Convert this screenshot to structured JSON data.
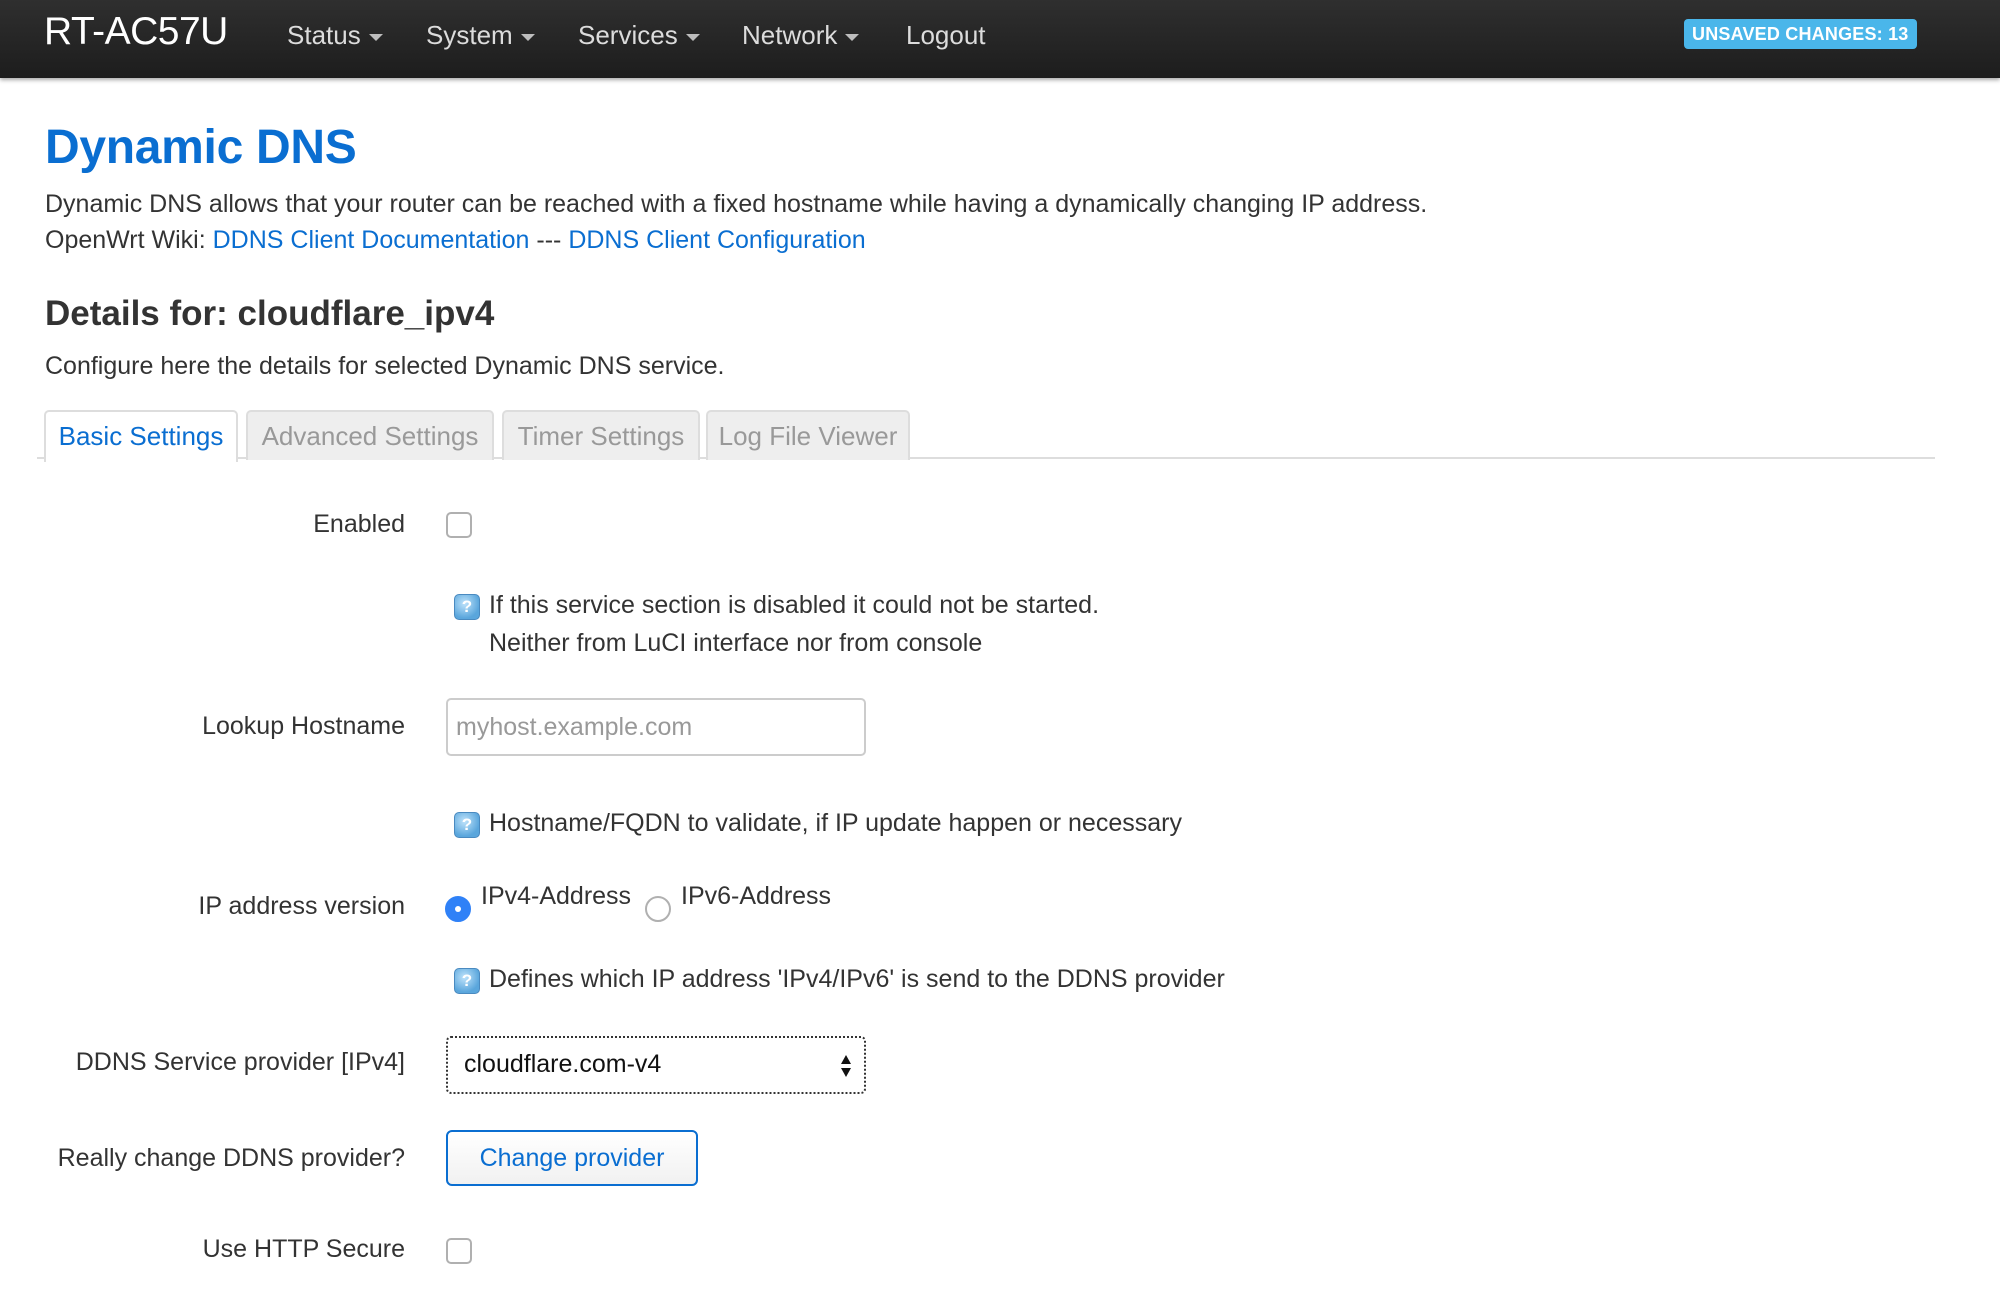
{
  "header": {
    "brand": "RT-AC57U",
    "nav": [
      "Status",
      "System",
      "Services",
      "Network",
      "Logout"
    ],
    "unsaved_badge": "UNSAVED CHANGES: 13"
  },
  "page": {
    "title": "Dynamic DNS",
    "description": "Dynamic DNS allows that your router can be reached with a fixed hostname while having a dynamically changing IP address.",
    "wiki_prefix": "OpenWrt Wiki:",
    "wiki_link_1": "DDNS Client Documentation",
    "wiki_separator": "---",
    "wiki_link_2": "DDNS Client Configuration"
  },
  "details": {
    "title": "Details for: cloudflare_ipv4",
    "subtitle": "Configure here the details for selected Dynamic DNS service."
  },
  "tabs": [
    {
      "label": "Basic Settings",
      "active": true
    },
    {
      "label": "Advanced Settings",
      "active": false
    },
    {
      "label": "Timer Settings",
      "active": false
    },
    {
      "label": "Log File Viewer",
      "active": false
    }
  ],
  "form": {
    "enabled": {
      "label": "Enabled",
      "checked": false,
      "help_line1": "If this service section is disabled it could not be started.",
      "help_line2": "Neither from LuCI interface nor from console"
    },
    "lookup_hostname": {
      "label": "Lookup Hostname",
      "value": "",
      "placeholder": "myhost.example.com",
      "help": "Hostname/FQDN to validate, if IP update happen or necessary"
    },
    "ip_version": {
      "label": "IP address version",
      "option_ipv4": "IPv4-Address",
      "option_ipv6": "IPv6-Address",
      "selected": "IPv4-Address",
      "help": "Defines which IP address 'IPv4/IPv6' is send to the DDNS provider"
    },
    "service_provider": {
      "label": "DDNS Service provider [IPv4]",
      "value": "cloudflare.com-v4"
    },
    "change_provider": {
      "label": "Really change DDNS provider?",
      "button": "Change provider"
    },
    "use_https": {
      "label": "Use HTTP Secure",
      "checked": false
    }
  },
  "colors": {
    "accent": "#0a6ed1",
    "navbar": "#222222",
    "badge": "#4ab6ea",
    "radio_checked": "#2f81f7"
  }
}
